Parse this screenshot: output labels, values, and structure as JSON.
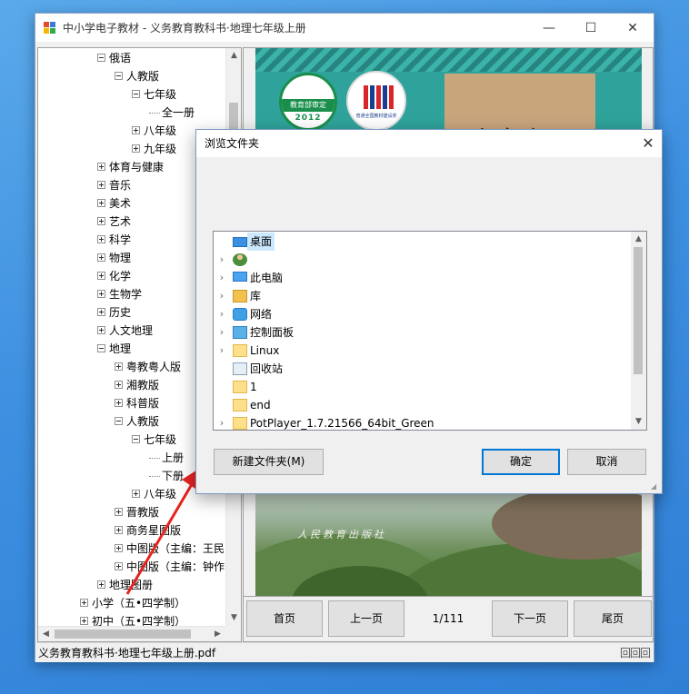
{
  "window": {
    "title": "中小学电子教材 - 义务教育教科书·地理七年级上册",
    "minimize": "—",
    "maximize": "☐",
    "close": "✕"
  },
  "tree": {
    "items": [
      {
        "label": "俄语",
        "indent": 0,
        "state": "minus"
      },
      {
        "label": "人教版",
        "indent": 1,
        "state": "minus"
      },
      {
        "label": "七年级",
        "indent": 2,
        "state": "minus"
      },
      {
        "label": "全一册",
        "indent": 3,
        "state": "leaf"
      },
      {
        "label": "八年级",
        "indent": 2,
        "state": "plus"
      },
      {
        "label": "九年级",
        "indent": 2,
        "state": "plus"
      },
      {
        "label": "体育与健康",
        "indent": 0,
        "state": "plus"
      },
      {
        "label": "音乐",
        "indent": 0,
        "state": "plus"
      },
      {
        "label": "美术",
        "indent": 0,
        "state": "plus"
      },
      {
        "label": "艺术",
        "indent": 0,
        "state": "plus"
      },
      {
        "label": "科学",
        "indent": 0,
        "state": "plus"
      },
      {
        "label": "物理",
        "indent": 0,
        "state": "plus"
      },
      {
        "label": "化学",
        "indent": 0,
        "state": "plus"
      },
      {
        "label": "生物学",
        "indent": 0,
        "state": "plus"
      },
      {
        "label": "历史",
        "indent": 0,
        "state": "plus"
      },
      {
        "label": "人文地理",
        "indent": 0,
        "state": "plus"
      },
      {
        "label": "地理",
        "indent": 0,
        "state": "minus"
      },
      {
        "label": "粤教粤人版",
        "indent": 1,
        "state": "plus"
      },
      {
        "label": "湘教版",
        "indent": 1,
        "state": "plus"
      },
      {
        "label": "科普版",
        "indent": 1,
        "state": "plus"
      },
      {
        "label": "人教版",
        "indent": 1,
        "state": "minus"
      },
      {
        "label": "七年级",
        "indent": 2,
        "state": "minus"
      },
      {
        "label": "上册",
        "indent": 3,
        "state": "leaf"
      },
      {
        "label": "下册",
        "indent": 3,
        "state": "leaf"
      },
      {
        "label": "八年级",
        "indent": 2,
        "state": "plus"
      },
      {
        "label": "晋教版",
        "indent": 1,
        "state": "plus"
      },
      {
        "label": "商务星图版",
        "indent": 1,
        "state": "plus"
      },
      {
        "label": "中图版（主编：王民",
        "indent": 1,
        "state": "plus"
      },
      {
        "label": "中图版（主编：钟作",
        "indent": 1,
        "state": "plus"
      },
      {
        "label": "地理图册",
        "indent": 0,
        "state": "plus"
      },
      {
        "label": "小学（五•四学制）",
        "indent": -1,
        "state": "plus"
      },
      {
        "label": "初中（五•四学制）",
        "indent": -1,
        "state": "plus"
      }
    ]
  },
  "cover": {
    "seal_a_band": "教育部审定",
    "seal_a_year": "2012",
    "seal_b_caption": "普通全国教材建设奖",
    "grade_text": "七年级",
    "publisher": "人民教育出版社"
  },
  "nav": {
    "first": "首页",
    "prev": "上一页",
    "page": "1/111",
    "next": "下一页",
    "last": "尾页"
  },
  "status": {
    "file": "义务教育教科书·地理七年级上册.pdf",
    "grip": "回回回"
  },
  "dialog": {
    "title": "浏览文件夹",
    "close": "✕",
    "folders": [
      {
        "label": "桌面",
        "icon": "desktop-icon",
        "chevron": false,
        "selected": true
      },
      {
        "label": "",
        "icon": "user-icon",
        "chevron": true,
        "selected": false
      },
      {
        "label": "此电脑",
        "icon": "computer-icon",
        "chevron": true,
        "selected": false
      },
      {
        "label": "库",
        "icon": "library-icon",
        "chevron": true,
        "selected": false
      },
      {
        "label": "网络",
        "icon": "network-icon",
        "chevron": true,
        "selected": false
      },
      {
        "label": "控制面板",
        "icon": "control-panel-icon",
        "chevron": true,
        "selected": false
      },
      {
        "label": "Linux",
        "icon": "folder-icon",
        "chevron": true,
        "selected": false
      },
      {
        "label": "回收站",
        "icon": "recycle-bin-icon",
        "chevron": false,
        "selected": false
      },
      {
        "label": "1",
        "icon": "folder-icon",
        "chevron": false,
        "selected": false
      },
      {
        "label": "end",
        "icon": "folder-icon",
        "chevron": false,
        "selected": false
      },
      {
        "label": "PotPlayer_1.7.21566_64bit_Green",
        "icon": "folder-icon",
        "chevron": true,
        "selected": false
      }
    ],
    "new_folder": "新建文件夹(M)",
    "ok": "确定",
    "cancel": "取消"
  },
  "colors": {
    "accent": "#0078d7",
    "selection": "#cce8ff",
    "arrow": "#e8231f"
  }
}
